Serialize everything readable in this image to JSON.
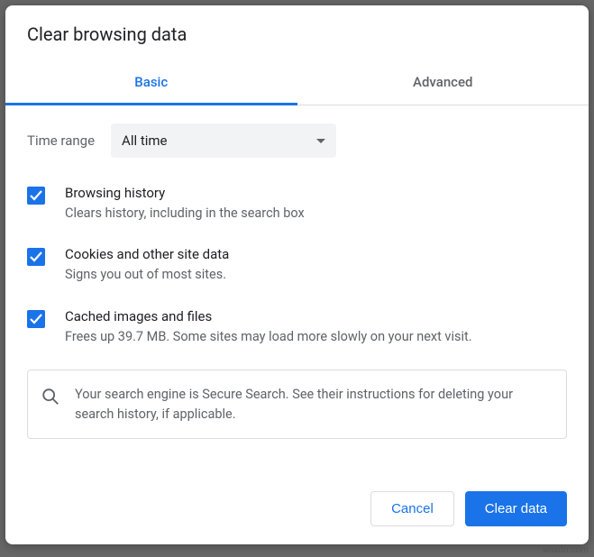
{
  "title": "Clear browsing data",
  "tabs": {
    "basic": "Basic",
    "advanced": "Advanced"
  },
  "time": {
    "label": "Time range",
    "value": "All time"
  },
  "options": [
    {
      "title": "Browsing history",
      "desc": "Clears history, including in the search box"
    },
    {
      "title": "Cookies and other site data",
      "desc": "Signs you out of most sites."
    },
    {
      "title": "Cached images and files",
      "desc": "Frees up 39.7 MB. Some sites may load more slowly on your next visit."
    }
  ],
  "notice": "Your search engine is Secure Search. See their instructions for deleting your search history, if applicable.",
  "buttons": {
    "cancel": "Cancel",
    "confirm": "Clear data"
  },
  "watermark": "wsxdn.com"
}
